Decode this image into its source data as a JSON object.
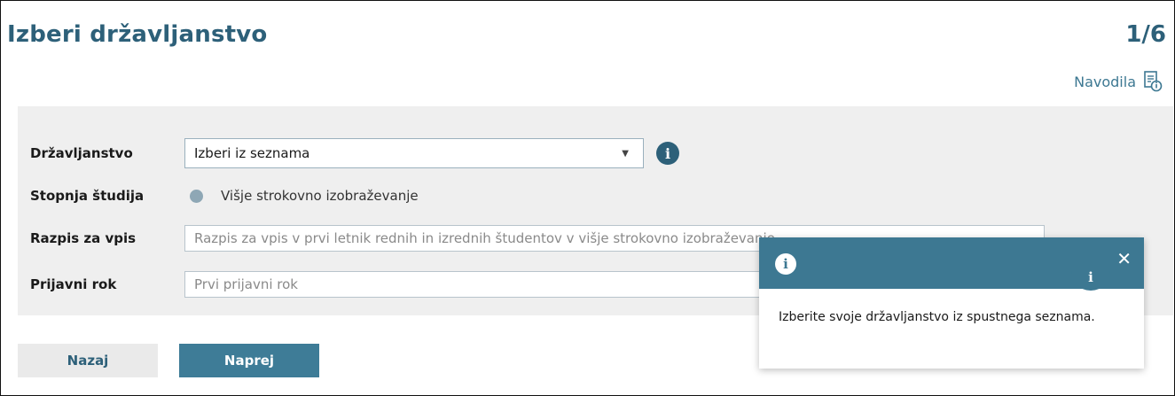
{
  "header": {
    "title": "Izberi državljanstvo",
    "step": "1/6",
    "help_label": "Navodila"
  },
  "form": {
    "citizenship": {
      "label": "Državljanstvo",
      "value": "Izberi iz seznama",
      "info_glyph": "i"
    },
    "study_level": {
      "label": "Stopnja študija",
      "option": "Višje strokovno izobraževanje"
    },
    "call": {
      "label": "Razpis za vpis",
      "placeholder": "Razpis za vpis v prvi letnik rednih in izrednih študentov v višje strokovno izobraževanje"
    },
    "deadline": {
      "label": "Prijavni rok",
      "placeholder": "Prvi prijavni rok"
    }
  },
  "buttons": {
    "back": "Nazaj",
    "next": "Naprej"
  },
  "tooltip": {
    "info_glyph": "i",
    "close_glyph": "✕",
    "text": "Izberite svoje državljanstvo iz spustnega seznama."
  },
  "colors": {
    "primary": "#2d6079",
    "accent": "#3d7892",
    "panel_bg": "#efefef"
  }
}
